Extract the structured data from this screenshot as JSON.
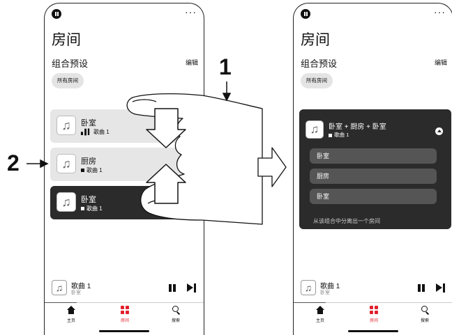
{
  "callouts": {
    "one": "1",
    "two": "2"
  },
  "before": {
    "title": "房间",
    "section": "组合预设",
    "edit": "编辑",
    "chip": "所有房间",
    "cards": [
      {
        "name": "卧室",
        "sub": "歌曲 1",
        "indicator": "equalizer-bars"
      },
      {
        "name": "厨房",
        "sub": "歌曲 1",
        "indicator": "square"
      },
      {
        "name": "卧室",
        "sub": "歌曲 1",
        "indicator": "square"
      }
    ],
    "player": {
      "name": "歌曲 1",
      "sub": "卧室"
    },
    "tabs": [
      "主页",
      "房间",
      "搜索"
    ]
  },
  "after": {
    "title": "房间",
    "section": "组合预设",
    "edit": "编辑",
    "chip": "所有房间",
    "group": {
      "name": "卧室 + 厨房 + 卧室",
      "sub": "歌曲 1",
      "members": [
        "卧室",
        "厨房",
        "卧室"
      ],
      "separate": "从该组合中分离出一个房间"
    },
    "player": {
      "name": "歌曲 1",
      "sub": "卧室"
    },
    "tabs": [
      "主页",
      "房间",
      "搜索"
    ]
  },
  "colors": {
    "accent": "#e2202c",
    "dark_card": "#2b2b2b",
    "light_card": "#e6e6e6"
  }
}
